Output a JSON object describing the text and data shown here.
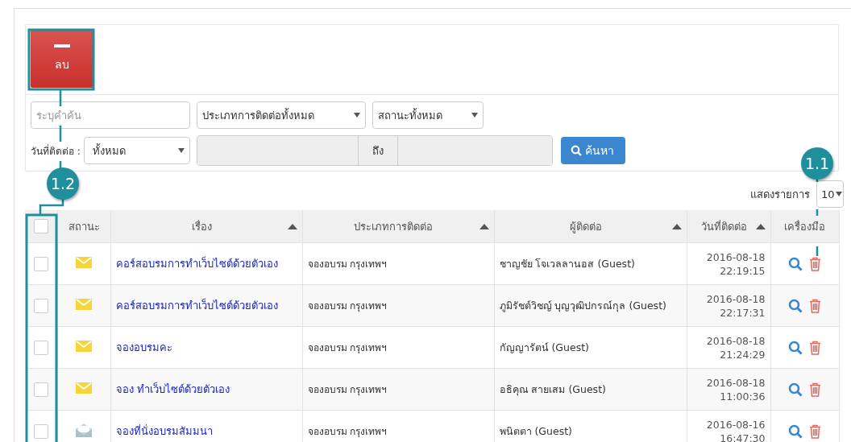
{
  "toolbar": {
    "delete_button": {
      "label": "ลบ"
    }
  },
  "filters": {
    "search": {
      "placeholder": "ระบุคำค้น"
    },
    "type_select": {
      "value": "ประเภทการติดต่อทั้งหมด"
    },
    "status_select": {
      "value": "สถานะทั้งหมด"
    },
    "date_label": "วันที่ติดต่อ :",
    "date_select": {
      "value": "ทั้งหมด"
    },
    "range_separator": "ถึง",
    "search_button": {
      "label": "ค้นหา"
    }
  },
  "page_size": {
    "label": "แสดงรายการ",
    "value": "10"
  },
  "table": {
    "columns": [
      {
        "label": "สถานะ",
        "sortable": false
      },
      {
        "label": "เรื่อง",
        "sortable": true
      },
      {
        "label": "ประเภทการติดต่อ",
        "sortable": true
      },
      {
        "label": "ผู้ติดต่อ",
        "sortable": true
      },
      {
        "label": "วันที่ติดต่อ",
        "sortable": true
      },
      {
        "label": "เครื่องมือ",
        "sortable": false
      }
    ],
    "header_checked": false,
    "rows": [
      {
        "checked": false,
        "read": false,
        "subject": "คอร์สอบรมการทำเว็บไซต์ด้วยตัวเอง",
        "type": "จองอบรม กรุงเทพฯ",
        "contact": "ชาญชัย โจเวลลานอส (Guest)",
        "date": "2016-08-18",
        "time": "22:19:15"
      },
      {
        "checked": false,
        "read": false,
        "subject": "คอร์สอบรมการทำเว็บไซต์ด้วยตัวเอง",
        "type": "จองอบรม กรุงเทพฯ",
        "contact": "ภูมิรัชต์วิชญ์ บุญวุฒิปกรณ์กุล (Guest)",
        "date": "2016-08-18",
        "time": "22:17:31"
      },
      {
        "checked": false,
        "read": false,
        "subject": "จองอบรมคะ",
        "type": "จองอบรม กรุงเทพฯ",
        "contact": "กัญญารัตน์ (Guest)",
        "date": "2016-08-18",
        "time": "21:24:29"
      },
      {
        "checked": false,
        "read": false,
        "subject": "จอง ทำเว็บไซต์ด้วยตัวเอง",
        "type": "จองอบรม กรุงเทพฯ",
        "contact": "อธิคุณ สายเสม (Guest)",
        "date": "2016-08-18",
        "time": "11:00:36"
      },
      {
        "checked": false,
        "read": true,
        "subject": "จองที่นั่งอบรมสัมมนา",
        "type": "จองอบรม กรุงเทพฯ",
        "contact": "พนิตตา (Guest)",
        "date": "2016-08-16",
        "time": "16:47:30"
      }
    ]
  },
  "annotations": [
    {
      "label": "1.2"
    },
    {
      "label": "1.1"
    }
  ]
}
